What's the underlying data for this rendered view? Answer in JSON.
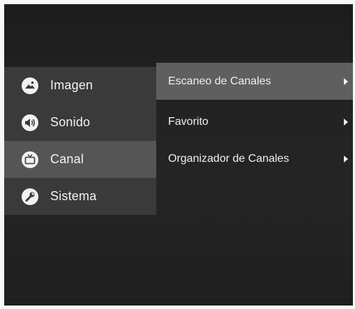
{
  "left_menu": {
    "items": [
      {
        "label": "Imagen",
        "icon": "picture-icon",
        "selected": false
      },
      {
        "label": "Sonido",
        "icon": "speaker-icon",
        "selected": false
      },
      {
        "label": "Canal",
        "icon": "tv-icon",
        "selected": true
      },
      {
        "label": "Sistema",
        "icon": "wrench-icon",
        "selected": false
      }
    ]
  },
  "right_menu": {
    "items": [
      {
        "label": "Escaneo de Canales",
        "selected": true
      },
      {
        "label": "Favorito",
        "selected": false
      },
      {
        "label": "Organizador de Canales",
        "selected": false
      }
    ]
  },
  "colors": {
    "selected_left": "#555555",
    "selected_right": "#5f5f5f",
    "panel_left": "#3a3a3a",
    "background": "#222222"
  }
}
